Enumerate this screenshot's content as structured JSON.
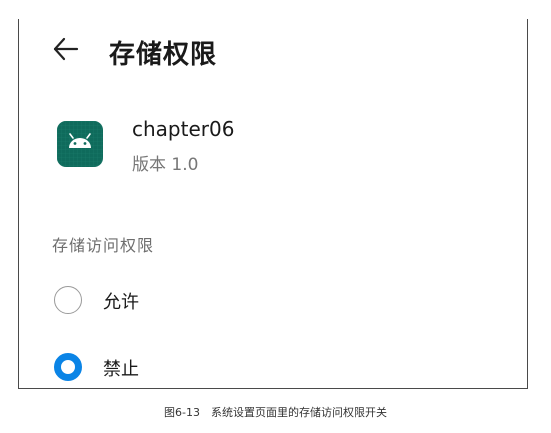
{
  "header": {
    "title": "存储权限",
    "back_icon": "arrow-left-icon"
  },
  "app": {
    "name": "chapter06",
    "version": "版本 1.0",
    "icon": "android-icon",
    "icon_color": "#0f6b5c"
  },
  "permission": {
    "section_label": "存储访问权限",
    "options": [
      {
        "label": "允许",
        "selected": false
      },
      {
        "label": "禁止",
        "selected": true
      }
    ],
    "selected_color": "#0a84e6"
  },
  "caption": "图6-13　系统设置页面里的存储访问权限开关"
}
